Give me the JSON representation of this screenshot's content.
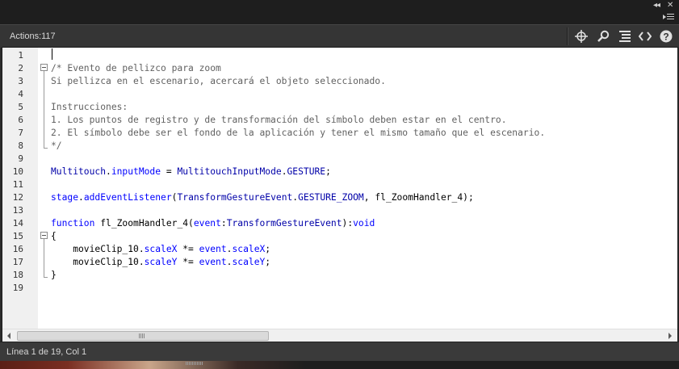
{
  "panel": {
    "title": "Actions:117"
  },
  "toolbar": {
    "icons": [
      "target-icon",
      "search-icon",
      "format-code-icon",
      "code-snippet-icon",
      "help-icon"
    ]
  },
  "editor": {
    "line_numbers": [
      "1",
      "2",
      "3",
      "4",
      "5",
      "6",
      "7",
      "8",
      "9",
      "10",
      "11",
      "12",
      "13",
      "14",
      "15",
      "16",
      "17",
      "18",
      "19"
    ],
    "lines": [
      [],
      [
        {
          "t": "/* Evento de pellizco para zoom",
          "c": "comment"
        }
      ],
      [
        {
          "t": "Si pellizca en el escenario, acercará el objeto seleccionado.",
          "c": "comment"
        }
      ],
      [],
      [
        {
          "t": "Instrucciones:",
          "c": "comment"
        }
      ],
      [
        {
          "t": "1. Los puntos de registro y de transformación del símbolo deben estar en el centro.",
          "c": "comment"
        }
      ],
      [
        {
          "t": "2. El símbolo debe ser el fondo de la aplicación y tener el mismo tamaño que el escenario.",
          "c": "comment"
        }
      ],
      [
        {
          "t": "*/",
          "c": "comment"
        }
      ],
      [],
      [
        {
          "t": "Multitouch",
          "c": "class"
        },
        {
          "t": ".",
          "c": "plain"
        },
        {
          "t": "inputMode",
          "c": "prop"
        },
        {
          "t": " = ",
          "c": "plain"
        },
        {
          "t": "MultitouchInputMode",
          "c": "class"
        },
        {
          "t": ".",
          "c": "plain"
        },
        {
          "t": "GESTURE",
          "c": "const"
        },
        {
          "t": ";",
          "c": "plain"
        }
      ],
      [],
      [
        {
          "t": "stage",
          "c": "prop"
        },
        {
          "t": ".",
          "c": "plain"
        },
        {
          "t": "addEventListener",
          "c": "prop"
        },
        {
          "t": "(",
          "c": "plain"
        },
        {
          "t": "TransformGestureEvent",
          "c": "class"
        },
        {
          "t": ".",
          "c": "plain"
        },
        {
          "t": "GESTURE_ZOOM",
          "c": "const"
        },
        {
          "t": ", fl_ZoomHandler_4);",
          "c": "plain"
        }
      ],
      [],
      [
        {
          "t": "function",
          "c": "kw"
        },
        {
          "t": " fl_ZoomHandler_4(",
          "c": "plain"
        },
        {
          "t": "event",
          "c": "prop"
        },
        {
          "t": ":",
          "c": "plain"
        },
        {
          "t": "TransformGestureEvent",
          "c": "type"
        },
        {
          "t": "):",
          "c": "plain"
        },
        {
          "t": "void",
          "c": "kw"
        }
      ],
      [
        {
          "t": "{",
          "c": "plain"
        }
      ],
      [
        {
          "t": "    movieClip_10.",
          "c": "plain"
        },
        {
          "t": "scaleX",
          "c": "prop"
        },
        {
          "t": " *= ",
          "c": "plain"
        },
        {
          "t": "event",
          "c": "prop"
        },
        {
          "t": ".",
          "c": "plain"
        },
        {
          "t": "scaleX",
          "c": "prop"
        },
        {
          "t": ";",
          "c": "plain"
        }
      ],
      [
        {
          "t": "    movieClip_10.",
          "c": "plain"
        },
        {
          "t": "scaleY",
          "c": "prop"
        },
        {
          "t": " *= ",
          "c": "plain"
        },
        {
          "t": "event",
          "c": "prop"
        },
        {
          "t": ".",
          "c": "plain"
        },
        {
          "t": "scaleY",
          "c": "prop"
        },
        {
          "t": ";",
          "c": "plain"
        }
      ],
      [
        {
          "t": "}",
          "c": "plain"
        }
      ],
      []
    ]
  },
  "status": {
    "text": "Línea 1 de 19, Col 1"
  },
  "colors": {
    "comment": "#616161",
    "class": "#0000a8",
    "keyword": "#0000ff",
    "property": "#0000ff",
    "panel_bg": "#353535",
    "editor_bg": "#ffffff"
  }
}
